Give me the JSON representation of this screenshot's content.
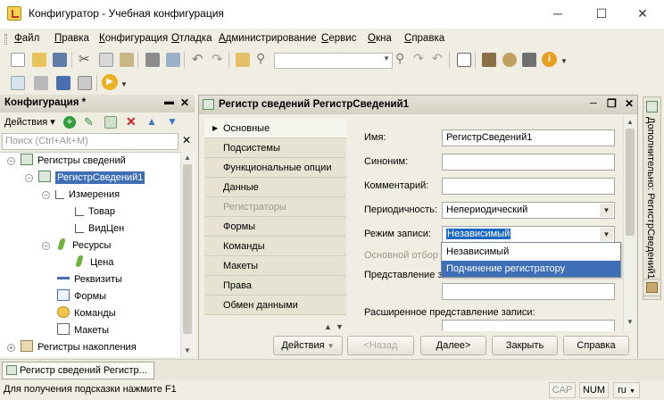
{
  "window": {
    "title": "Конфигуратор - Учебная конфигурация",
    "minimize": "─",
    "maximize": "☐",
    "close": "✕"
  },
  "menu": [
    "Файл",
    "Правка",
    "Конфигурация",
    "Отладка",
    "Администрирование",
    "Сервис",
    "Окна",
    "Справка"
  ],
  "config_panel": {
    "title": "Конфигурация *",
    "actions_label": "Действия",
    "search_placeholder": "Поиск (Ctrl+Alt+M)",
    "close": "✕",
    "pin": "▬"
  },
  "tree": [
    {
      "label": "Регистры сведений",
      "icon": "register-icon"
    },
    {
      "label": "РегистрСведений1",
      "icon": "register-icon",
      "selected": true
    },
    {
      "label": "Измерения",
      "icon": "dimension-icon"
    },
    {
      "label": "Товар",
      "icon": "dimension-icon"
    },
    {
      "label": "ВидЦен",
      "icon": "dimension-icon"
    },
    {
      "label": "Ресурсы",
      "icon": "resource-icon"
    },
    {
      "label": "Цена",
      "icon": "resource-icon"
    },
    {
      "label": "Реквизиты",
      "icon": "attribute-icon"
    },
    {
      "label": "Формы",
      "icon": "form-icon"
    },
    {
      "label": "Команды",
      "icon": "command-icon"
    },
    {
      "label": "Макеты",
      "icon": "template-icon"
    },
    {
      "label": "Регистры накопления",
      "icon": "accum-register-icon"
    }
  ],
  "editor": {
    "title": "Регистр сведений РегистрСведений1",
    "tabs": [
      "Основные",
      "Подсистемы",
      "Функциональные опции",
      "Данные",
      "Регистраторы",
      "Формы",
      "Команды",
      "Макеты",
      "Права",
      "Обмен данными"
    ],
    "active_tab": "Основные",
    "fields": {
      "name_label": "Имя:",
      "name_value": "РегистрСведений1",
      "synonym_label": "Синоним:",
      "synonym_value": "",
      "comment_label": "Комментарий:",
      "comment_value": "",
      "periodicity_label": "Периодичность:",
      "periodicity_value": "Непериодический",
      "write_mode_label": "Режим записи:",
      "write_mode_value": "Независимый",
      "main_filter_label": "Основной отбор п",
      "record_view_label": "Представление запи",
      "extended_record_view_label": "Расширенное представление записи:"
    },
    "dropdown_options": [
      "Независимый",
      "Подчинение регистратору"
    ],
    "buttons": {
      "actions": "Действия",
      "back": "<Назад",
      "next": "Далее>",
      "close": "Закрыть",
      "help": "Справка"
    },
    "side_tab": "Дополнительно: РегистрСведений1"
  },
  "taskbar": {
    "item": "Регистр сведений Регистр..."
  },
  "status": {
    "hint": "Для получения подсказки нажмите F1",
    "cap": "CAP",
    "num": "NUM",
    "lang": "ru"
  },
  "colors": {
    "selection": "#3e6fb6",
    "highlight": "#1b68c3",
    "bg": "#f0eee2",
    "tab_bg": "#e6e3d2"
  }
}
